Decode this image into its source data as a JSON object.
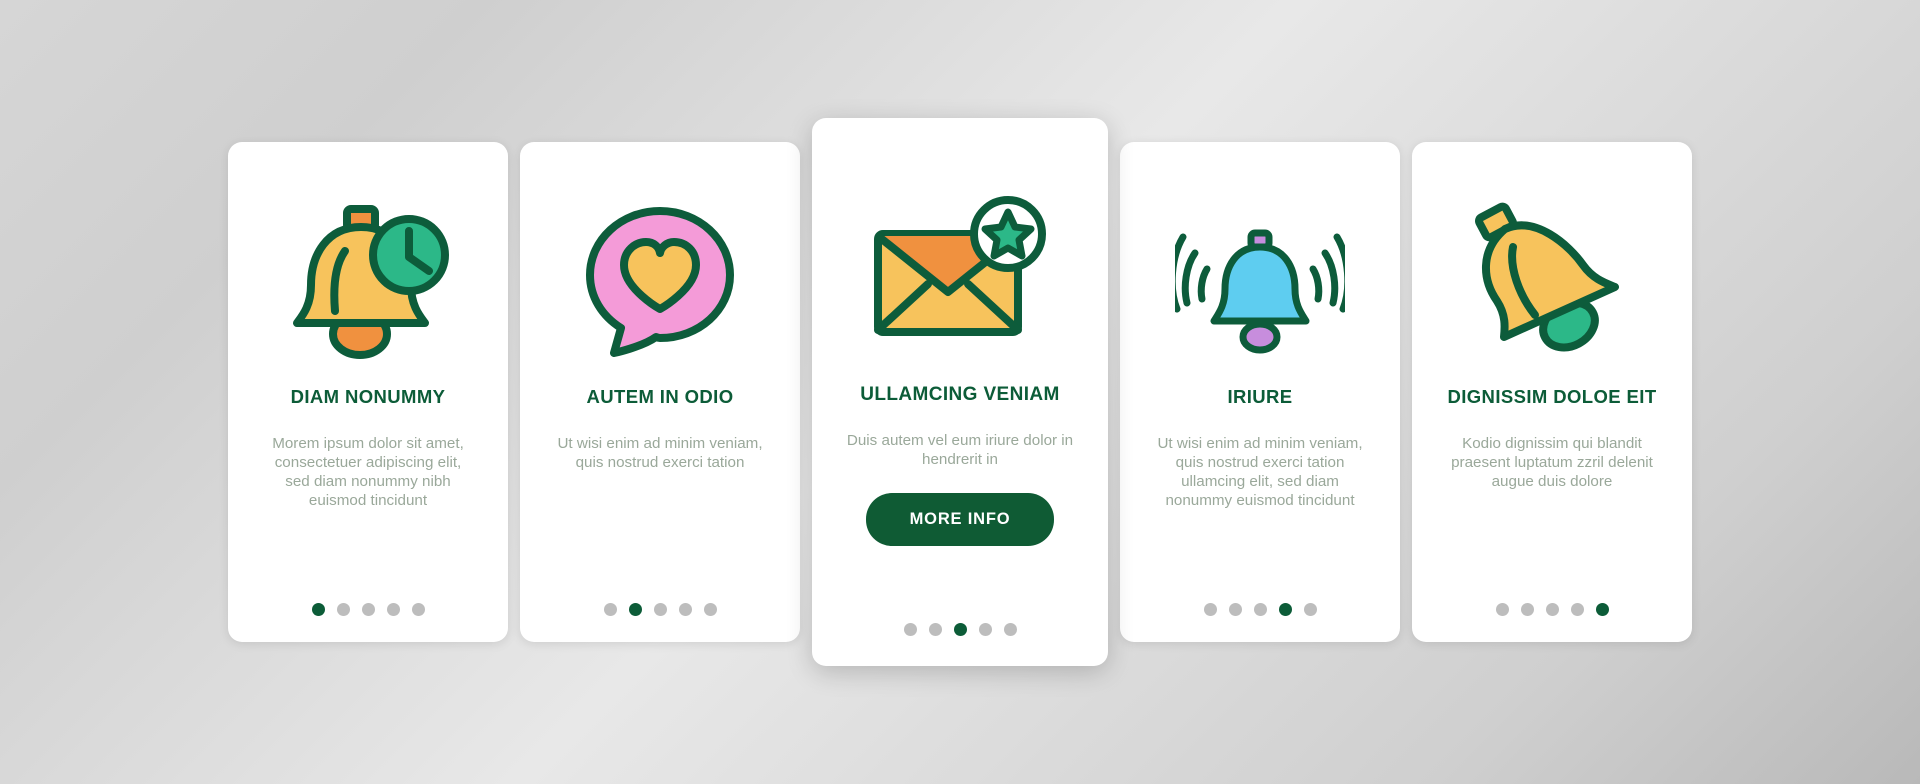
{
  "page": {
    "background_gradient_start": "#d6d6d6",
    "background_gradient_end": "#b9b9b9",
    "brand_green": "#0c5c38",
    "muted_text": "#9aa89a",
    "dot_inactive": "#bdbdbd"
  },
  "cards": [
    {
      "id": "card-diam-nonummy",
      "icon_name": "bell-clock-icon",
      "title": "DIAM NONUMMY",
      "body": "Morem ipsum dolor sit amet, consectetuer adipiscing elit, sed diam nonummy nibh euismod tincidunt",
      "featured": false,
      "cta_label": null,
      "dots": {
        "count": 5,
        "active_index": 0
      }
    },
    {
      "id": "card-autem-in-odio",
      "icon_name": "heart-chat-bubble-icon",
      "title": "AUTEM IN ODIO",
      "body": "Ut wisi enim ad minim veniam, quis nostrud exerci tation",
      "featured": false,
      "cta_label": null,
      "dots": {
        "count": 5,
        "active_index": 1
      }
    },
    {
      "id": "card-ullamcing-veniam",
      "icon_name": "envelope-star-icon",
      "title": "ULLAMCING VENIAM",
      "body": "Duis autem vel eum iriure dolor in hendrerit in",
      "featured": true,
      "cta_label": "MORE INFO",
      "dots": {
        "count": 5,
        "active_index": 2
      }
    },
    {
      "id": "card-iriure",
      "icon_name": "ringing-bell-icon",
      "title": "IRIURE",
      "body": "Ut wisi enim ad minim veniam, quis nostrud exerci tation ullamcing elit, sed diam nonummy euismod tincidunt",
      "featured": false,
      "cta_label": null,
      "dots": {
        "count": 5,
        "active_index": 3
      }
    },
    {
      "id": "card-dignissim-doloe-eit",
      "icon_name": "tilted-bell-icon",
      "title": "DIGNISSIM DOLOE EIT",
      "body": "Kodio dignissim qui blandit praesent luptatum zzril delenit augue duis dolore",
      "featured": false,
      "cta_label": null,
      "dots": {
        "count": 5,
        "active_index": 4
      }
    }
  ],
  "icon_colors": {
    "outline": "#0d5c3b",
    "yellow": "#f7c35c",
    "orange": "#f0913f",
    "teal": "#2cb888",
    "pink": "#f49bd8",
    "blue": "#5ecdf0",
    "violet": "#c78ddd"
  }
}
